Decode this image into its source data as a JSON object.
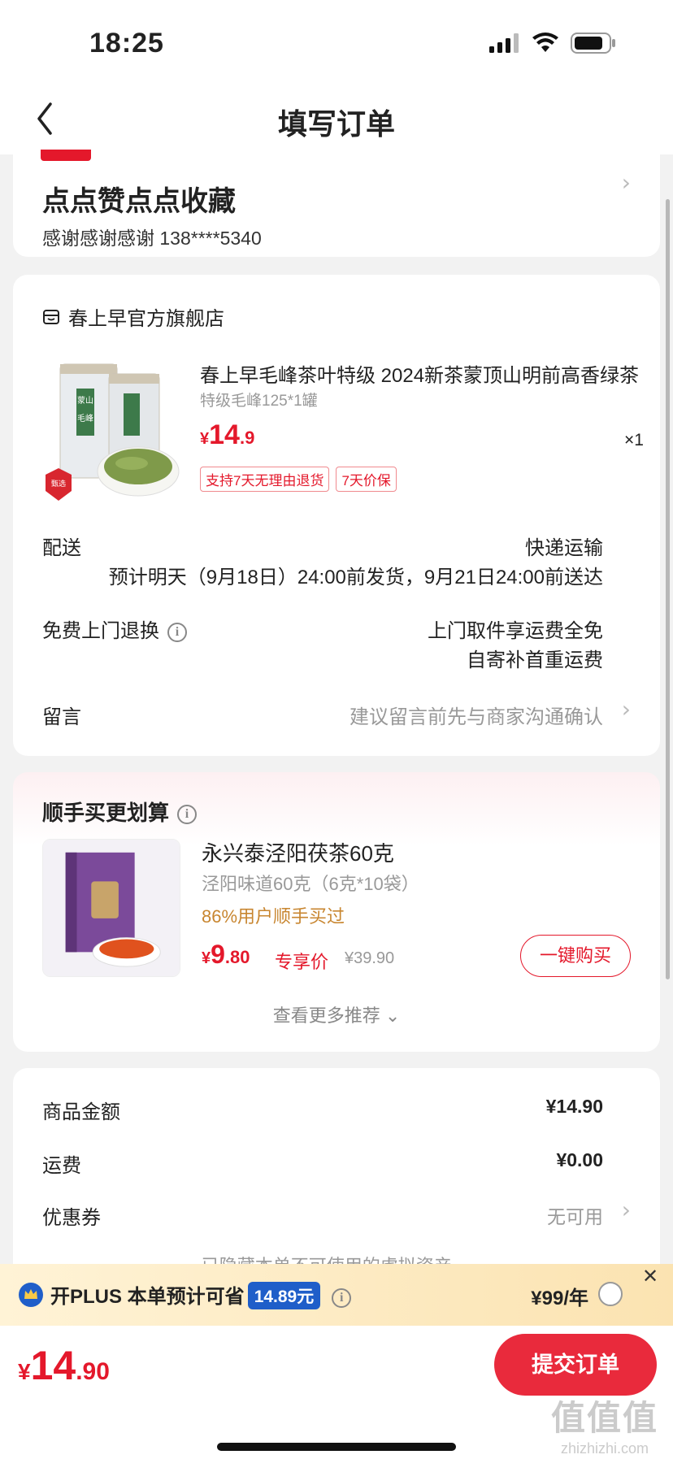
{
  "status_bar": {
    "time": "18:25"
  },
  "nav": {
    "title": "填写订单"
  },
  "address": {
    "name": "点点赞点点收藏",
    "contact": "感谢感谢感谢  138****5340"
  },
  "shop": {
    "name": "春上早官方旗舰店",
    "product": {
      "title": "春上早毛峰茶叶特级 2024新茶蒙顶山明前高香绿茶",
      "spec": "特级毛峰125*1罐",
      "price_yen": "¥",
      "price_int": "14",
      "price_dec": ".9",
      "qty": "×1",
      "tags": [
        "支持7天无理由退货",
        "7天价保"
      ],
      "image_text": "蒙山毛峰"
    },
    "delivery": {
      "label": "配送",
      "method": "快递运输",
      "eta": "预计明天（9月18日）24:00前发货，9月21日24:00前送达"
    },
    "return": {
      "label": "免费上门退换",
      "line1": "上门取件享运费全免",
      "line2": "自寄补首重运费"
    },
    "message": {
      "label": "留言",
      "placeholder": "建议留言前先与商家沟通确认"
    }
  },
  "recommend": {
    "title": "顺手买更划算",
    "item": {
      "name": "永兴泰泾阳茯茶60克",
      "spec": "泾阳味道60克（6克*10袋）",
      "bought": "86%用户顺手买过",
      "price_yen": "¥",
      "price_int": "9",
      "price_dec": ".80",
      "exclusive": "专享价",
      "original": "¥39.90",
      "buy_label": "一键购买"
    },
    "more_label": "查看更多推荐 ⌄"
  },
  "summary": {
    "goods_label": "商品金额",
    "goods_value": "¥14.90",
    "shipping_label": "运费",
    "shipping_value": "¥0.00",
    "coupon_label": "优惠券",
    "coupon_value": "无可用",
    "hidden_note": "已隐藏本单不可使用的虚拟资产 ⌄"
  },
  "plus": {
    "prefix": "开PLUS 本单预计可省",
    "amount": "14.89元",
    "price": "¥99/年",
    "close": "✕"
  },
  "bottom": {
    "yen": "¥",
    "int": "14",
    "dec": ".90",
    "submit": "提交订单"
  },
  "watermark": {
    "big": "值值值",
    "small": "zhizhizhi.com"
  },
  "colors": {
    "accent": "#e4182b",
    "plus_badge": "#1f5ec9",
    "gold": "#c88630"
  }
}
